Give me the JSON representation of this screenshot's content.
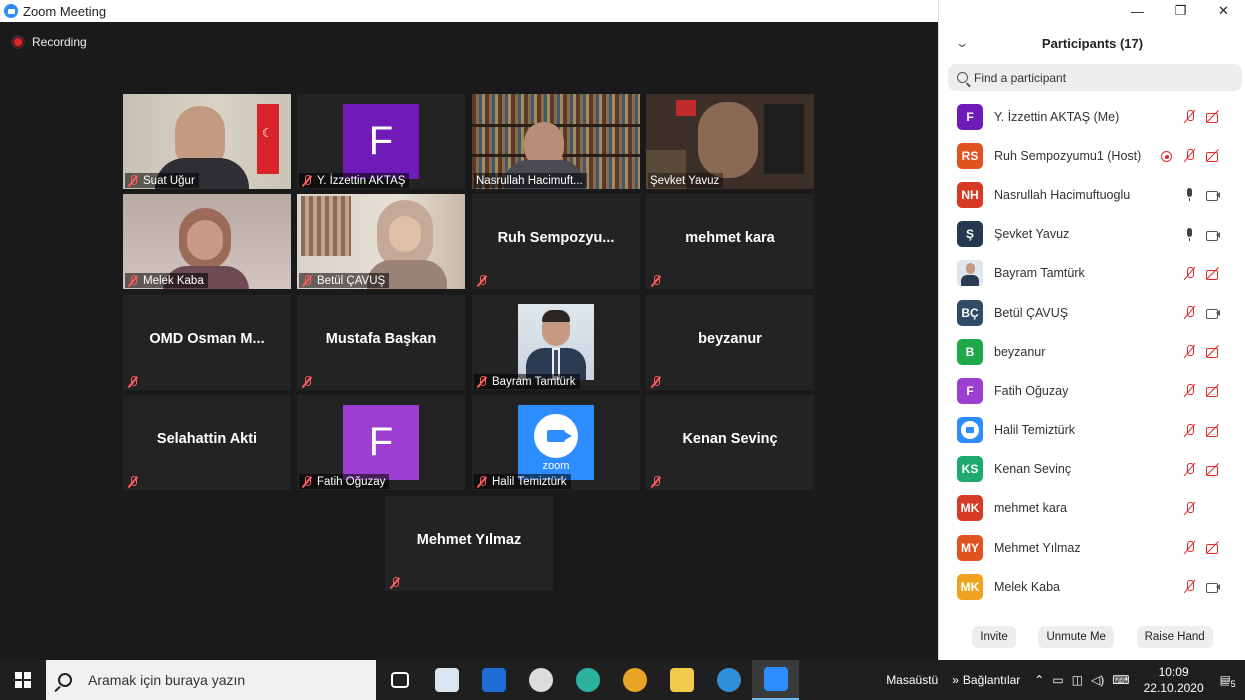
{
  "window": {
    "title": "Zoom Meeting",
    "buttons": {
      "minimize": "—",
      "maximize": "❐",
      "close": "✕"
    }
  },
  "recording": {
    "label": "Recording"
  },
  "tiles": [
    {
      "name": "Suat Uğur",
      "type": "video"
    },
    {
      "name": "Y. İzzettin AKTAŞ",
      "type": "avatar",
      "letter": "F",
      "color": "#6e1bb8"
    },
    {
      "name": "Nasrullah Hacimuft...",
      "type": "video"
    },
    {
      "name": "Şevket Yavuz",
      "type": "video",
      "speaking": true
    },
    {
      "name": "Melek Kaba",
      "type": "video"
    },
    {
      "name": "Betül ÇAVUŞ",
      "type": "video"
    },
    {
      "big": "Ruh Sempozyu...",
      "type": "name"
    },
    {
      "big": "mehmet kara",
      "type": "name"
    },
    {
      "big": "OMD Osman M...",
      "type": "name"
    },
    {
      "big": "Mustafa Başkan",
      "type": "name"
    },
    {
      "name": "Bayram Tamtürk",
      "type": "photo"
    },
    {
      "big": "beyzanur",
      "type": "name"
    },
    {
      "big": "Selahattin Akti",
      "type": "name"
    },
    {
      "name": "Fatih Oğuzay",
      "type": "avatar",
      "letter": "F",
      "color": "#9c3ecf"
    },
    {
      "name": "Halil Temiztürk",
      "type": "zoom",
      "logo_text": "zoom"
    },
    {
      "big": "Kenan Sevinç",
      "type": "name"
    },
    {
      "big": "Mehmet Yılmaz",
      "type": "name"
    }
  ],
  "panel": {
    "title": "Participants (17)",
    "search_placeholder": "Find a participant",
    "participants": [
      {
        "initials": "F",
        "color": "#6e1bb8",
        "name": "Y. İzzettin AKTAŞ (Me)",
        "rec": false,
        "mic": "off",
        "cam": "off"
      },
      {
        "initials": "RS",
        "color": "#e0531f",
        "name": "Ruh Sempozyumu1 (Host)",
        "rec": true,
        "mic": "off",
        "cam": "off"
      },
      {
        "initials": "NH",
        "color": "#d63a25",
        "name": "Nasrullah Hacimuftuoglu",
        "rec": false,
        "mic": "on",
        "cam": "on"
      },
      {
        "initials": "Ş",
        "color": "#24384f",
        "name": "Şevket Yavuz",
        "rec": false,
        "mic": "on",
        "cam": "on"
      },
      {
        "initials": "",
        "color": "#7a8a9a",
        "name": "Bayram Tamtürk",
        "rec": false,
        "mic": "off",
        "cam": "off",
        "photo": true
      },
      {
        "initials": "BÇ",
        "color": "#2f4b68",
        "name": "Betül ÇAVUŞ",
        "rec": false,
        "mic": "off",
        "cam": "on"
      },
      {
        "initials": "B",
        "color": "#1ea84a",
        "name": "beyzanur",
        "rec": false,
        "mic": "off",
        "cam": "off"
      },
      {
        "initials": "F",
        "color": "#9c3ecf",
        "name": "Fatih Oğuzay",
        "rec": false,
        "mic": "off",
        "cam": "off"
      },
      {
        "initials": "",
        "color": "#2d8cff",
        "name": "Halil Temiztürk",
        "rec": false,
        "mic": "off",
        "cam": "off",
        "zoom": true
      },
      {
        "initials": "KS",
        "color": "#1eaa6e",
        "name": "Kenan Sevinç",
        "rec": false,
        "mic": "off",
        "cam": "off"
      },
      {
        "initials": "MK",
        "color": "#d63a25",
        "name": "mehmet kara",
        "rec": false,
        "mic": "off",
        "cam": "none"
      },
      {
        "initials": "MY",
        "color": "#e0531f",
        "name": "Mehmet Yılmaz",
        "rec": false,
        "mic": "off",
        "cam": "off"
      },
      {
        "initials": "MK",
        "color": "#f0a320",
        "name": "Melek Kaba",
        "rec": false,
        "mic": "off",
        "cam": "on"
      }
    ],
    "footer": {
      "invite": "Invite",
      "unmute": "Unmute Me",
      "raise_hand": "Raise Hand"
    }
  },
  "taskbar": {
    "search_text": "Aramak için buraya yazın",
    "desktop_label": "Masaüstü",
    "links_label": "Bağlantılar",
    "time": "10:09",
    "date": "22.10.2020",
    "notifications": "5",
    "apps": [
      {
        "icon": "task-view-icon",
        "color": "#ffffff"
      },
      {
        "icon": "paint-icon",
        "color": "#d9e6f2"
      },
      {
        "icon": "mail-icon",
        "color": "#1d6ed8"
      },
      {
        "icon": "clock-app-icon",
        "color": "#dddddd"
      },
      {
        "icon": "edge-icon",
        "color": "#2bb3a0"
      },
      {
        "icon": "chrome-icon",
        "color": "#e8a526"
      },
      {
        "icon": "file-explorer-icon",
        "color": "#f2c94c"
      },
      {
        "icon": "internet-explorer-icon",
        "color": "#2f8fd8"
      },
      {
        "icon": "zoom-app-icon",
        "color": "#2d8cff"
      }
    ]
  }
}
